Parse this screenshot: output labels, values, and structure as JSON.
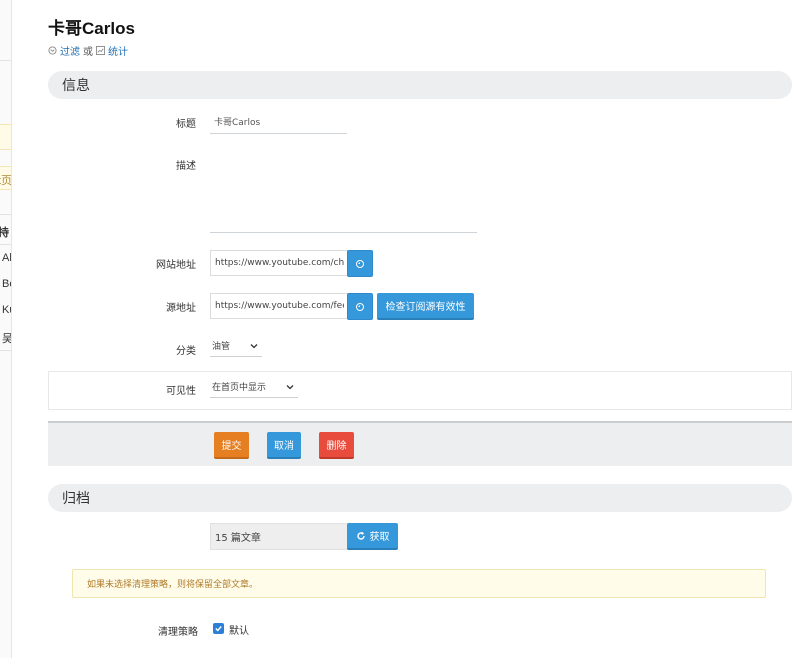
{
  "sidebar": {
    "fragments": [
      "t页",
      "持",
      "Al",
      "Be",
      "Ku",
      "吴"
    ]
  },
  "page": {
    "title": "卡哥Carlos",
    "links": {
      "filter": "过滤",
      "or": "或",
      "stats": "统计"
    }
  },
  "info": {
    "section_title": "信息",
    "title_label": "标题",
    "title_value": "卡哥Carlos",
    "description_label": "描述",
    "description_value": "",
    "website_label": "网站地址",
    "website_value": "https://www.youtube.com/channel/",
    "source_label": "源地址",
    "source_value": "https://www.youtube.com/feeds/",
    "validate_button": "检查订阅源有效性",
    "category_label": "分类",
    "category_value": "油管",
    "visibility_label": "可见性",
    "visibility_value": "在首页中显示"
  },
  "actions": {
    "submit": "提交",
    "cancel": "取消",
    "delete": "删除"
  },
  "archive": {
    "section_title": "归档",
    "count_value": "15 篇文章",
    "fetch_button": "获取",
    "notice": "如果未选择清理策略，则将保留全部文章。",
    "cleanup_label": "清理策略",
    "default_label": "默认",
    "default_checked": true
  },
  "colors": {
    "primary": "#3498db",
    "submit": "#e67e22",
    "delete": "#e74c3c",
    "section_bg": "#eceeef"
  }
}
